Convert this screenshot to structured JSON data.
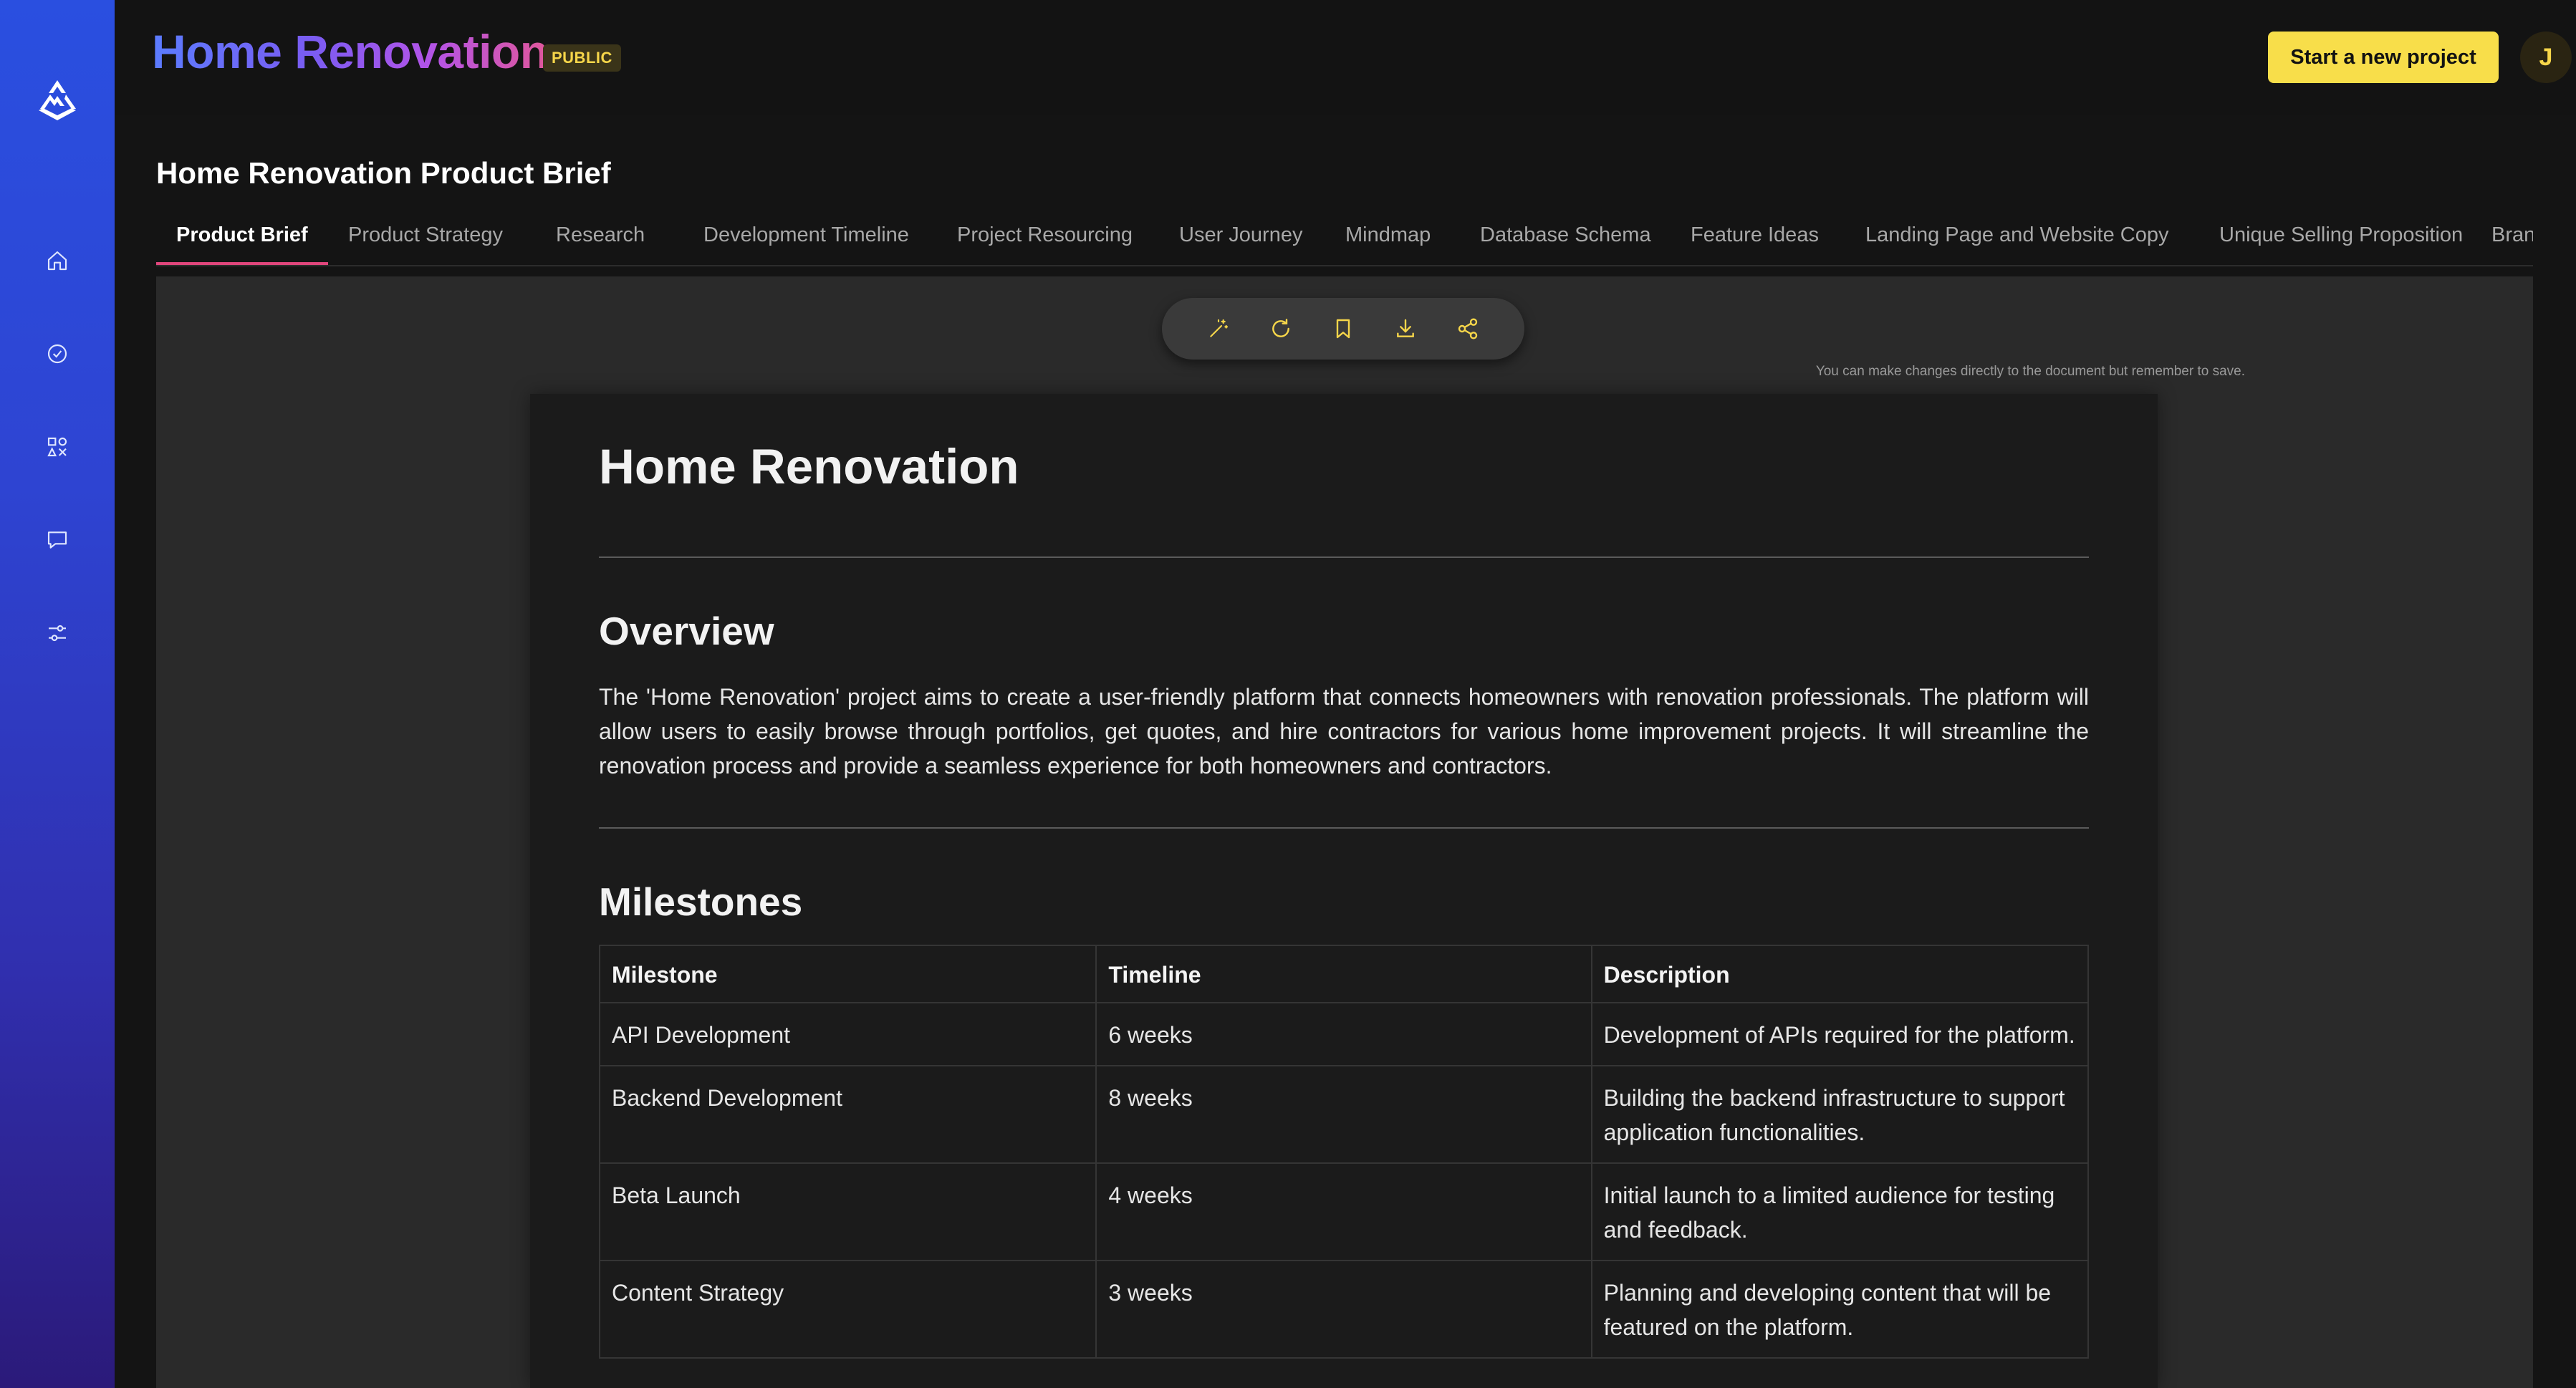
{
  "app": {
    "title": "Home Renovation",
    "visibility_badge": "PUBLIC"
  },
  "header": {
    "new_project_label": "Start a new project",
    "avatar_initial": "J"
  },
  "sidebar": {
    "logo_icon": "mountain-logo-icon",
    "items": [
      {
        "icon": "home-icon",
        "name": "home"
      },
      {
        "icon": "check-circle-icon",
        "name": "tasks"
      },
      {
        "icon": "shapes-icon",
        "name": "apps"
      },
      {
        "icon": "chat-icon",
        "name": "messages"
      },
      {
        "icon": "sliders-icon",
        "name": "settings"
      }
    ]
  },
  "page": {
    "title": "Home Renovation Product Brief"
  },
  "tabs": [
    {
      "label": "Product Brief",
      "active": true
    },
    {
      "label": "Product Strategy"
    },
    {
      "label": "Research"
    },
    {
      "label": "Development Timeline"
    },
    {
      "label": "Project Resourcing"
    },
    {
      "label": "User Journey"
    },
    {
      "label": "Mindmap"
    },
    {
      "label": "Database Schema"
    },
    {
      "label": "Feature Ideas"
    },
    {
      "label": "Landing Page and Website Copy"
    },
    {
      "label": "Unique Selling Proposition"
    },
    {
      "label": "Bran"
    }
  ],
  "toolbar": {
    "tools": [
      "magic-wand-icon",
      "refresh-icon",
      "bookmark-icon",
      "download-icon",
      "share-icon"
    ],
    "hint": "You can make changes directly to the document but remember to save."
  },
  "document": {
    "title": "Home Renovation",
    "overview_heading": "Overview",
    "overview_text": "The 'Home Renovation' project aims to create a user-friendly platform that connects homeowners with renovation professionals. The platform will allow users to easily browse through portfolios, get quotes, and hire contractors for various home improvement projects. It will streamline the renovation process and provide a seamless experience for both homeowners and contractors.",
    "milestones_heading": "Milestones",
    "milestones_table": {
      "headers": [
        "Milestone",
        "Timeline",
        "Description"
      ],
      "rows": [
        [
          "API Development",
          "6 weeks",
          "Development of APIs required for the platform."
        ],
        [
          "Backend Development",
          "8 weeks",
          "Building the backend infrastructure to support application functionalities."
        ],
        [
          "Beta Launch",
          "4 weeks",
          "Initial launch to a limited audience for testing and feedback."
        ],
        [
          "Content Strategy",
          "3 weeks",
          "Planning and developing content that will be featured on the platform."
        ]
      ]
    }
  },
  "colors": {
    "accent_yellow": "#f8de4a",
    "tab_active_underline": "#e0467c",
    "sidebar_top": "#2a4fe0",
    "sidebar_bottom": "#2b1a7a"
  }
}
